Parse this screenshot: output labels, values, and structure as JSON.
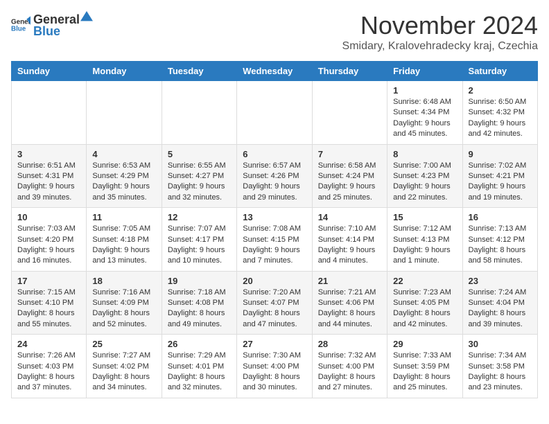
{
  "logo": {
    "text_general": "General",
    "text_blue": "Blue"
  },
  "header": {
    "month": "November 2024",
    "subtitle": "Smidary, Kralovehradecky kraj, Czechia"
  },
  "days_of_week": [
    "Sunday",
    "Monday",
    "Tuesday",
    "Wednesday",
    "Thursday",
    "Friday",
    "Saturday"
  ],
  "weeks": [
    [
      {
        "day": "",
        "info": ""
      },
      {
        "day": "",
        "info": ""
      },
      {
        "day": "",
        "info": ""
      },
      {
        "day": "",
        "info": ""
      },
      {
        "day": "",
        "info": ""
      },
      {
        "day": "1",
        "info": "Sunrise: 6:48 AM\nSunset: 4:34 PM\nDaylight: 9 hours and 45 minutes."
      },
      {
        "day": "2",
        "info": "Sunrise: 6:50 AM\nSunset: 4:32 PM\nDaylight: 9 hours and 42 minutes."
      }
    ],
    [
      {
        "day": "3",
        "info": "Sunrise: 6:51 AM\nSunset: 4:31 PM\nDaylight: 9 hours and 39 minutes."
      },
      {
        "day": "4",
        "info": "Sunrise: 6:53 AM\nSunset: 4:29 PM\nDaylight: 9 hours and 35 minutes."
      },
      {
        "day": "5",
        "info": "Sunrise: 6:55 AM\nSunset: 4:27 PM\nDaylight: 9 hours and 32 minutes."
      },
      {
        "day": "6",
        "info": "Sunrise: 6:57 AM\nSunset: 4:26 PM\nDaylight: 9 hours and 29 minutes."
      },
      {
        "day": "7",
        "info": "Sunrise: 6:58 AM\nSunset: 4:24 PM\nDaylight: 9 hours and 25 minutes."
      },
      {
        "day": "8",
        "info": "Sunrise: 7:00 AM\nSunset: 4:23 PM\nDaylight: 9 hours and 22 minutes."
      },
      {
        "day": "9",
        "info": "Sunrise: 7:02 AM\nSunset: 4:21 PM\nDaylight: 9 hours and 19 minutes."
      }
    ],
    [
      {
        "day": "10",
        "info": "Sunrise: 7:03 AM\nSunset: 4:20 PM\nDaylight: 9 hours and 16 minutes."
      },
      {
        "day": "11",
        "info": "Sunrise: 7:05 AM\nSunset: 4:18 PM\nDaylight: 9 hours and 13 minutes."
      },
      {
        "day": "12",
        "info": "Sunrise: 7:07 AM\nSunset: 4:17 PM\nDaylight: 9 hours and 10 minutes."
      },
      {
        "day": "13",
        "info": "Sunrise: 7:08 AM\nSunset: 4:15 PM\nDaylight: 9 hours and 7 minutes."
      },
      {
        "day": "14",
        "info": "Sunrise: 7:10 AM\nSunset: 4:14 PM\nDaylight: 9 hours and 4 minutes."
      },
      {
        "day": "15",
        "info": "Sunrise: 7:12 AM\nSunset: 4:13 PM\nDaylight: 9 hours and 1 minute."
      },
      {
        "day": "16",
        "info": "Sunrise: 7:13 AM\nSunset: 4:12 PM\nDaylight: 8 hours and 58 minutes."
      }
    ],
    [
      {
        "day": "17",
        "info": "Sunrise: 7:15 AM\nSunset: 4:10 PM\nDaylight: 8 hours and 55 minutes."
      },
      {
        "day": "18",
        "info": "Sunrise: 7:16 AM\nSunset: 4:09 PM\nDaylight: 8 hours and 52 minutes."
      },
      {
        "day": "19",
        "info": "Sunrise: 7:18 AM\nSunset: 4:08 PM\nDaylight: 8 hours and 49 minutes."
      },
      {
        "day": "20",
        "info": "Sunrise: 7:20 AM\nSunset: 4:07 PM\nDaylight: 8 hours and 47 minutes."
      },
      {
        "day": "21",
        "info": "Sunrise: 7:21 AM\nSunset: 4:06 PM\nDaylight: 8 hours and 44 minutes."
      },
      {
        "day": "22",
        "info": "Sunrise: 7:23 AM\nSunset: 4:05 PM\nDaylight: 8 hours and 42 minutes."
      },
      {
        "day": "23",
        "info": "Sunrise: 7:24 AM\nSunset: 4:04 PM\nDaylight: 8 hours and 39 minutes."
      }
    ],
    [
      {
        "day": "24",
        "info": "Sunrise: 7:26 AM\nSunset: 4:03 PM\nDaylight: 8 hours and 37 minutes."
      },
      {
        "day": "25",
        "info": "Sunrise: 7:27 AM\nSunset: 4:02 PM\nDaylight: 8 hours and 34 minutes."
      },
      {
        "day": "26",
        "info": "Sunrise: 7:29 AM\nSunset: 4:01 PM\nDaylight: 8 hours and 32 minutes."
      },
      {
        "day": "27",
        "info": "Sunrise: 7:30 AM\nSunset: 4:00 PM\nDaylight: 8 hours and 30 minutes."
      },
      {
        "day": "28",
        "info": "Sunrise: 7:32 AM\nSunset: 4:00 PM\nDaylight: 8 hours and 27 minutes."
      },
      {
        "day": "29",
        "info": "Sunrise: 7:33 AM\nSunset: 3:59 PM\nDaylight: 8 hours and 25 minutes."
      },
      {
        "day": "30",
        "info": "Sunrise: 7:34 AM\nSunset: 3:58 PM\nDaylight: 8 hours and 23 minutes."
      }
    ]
  ]
}
